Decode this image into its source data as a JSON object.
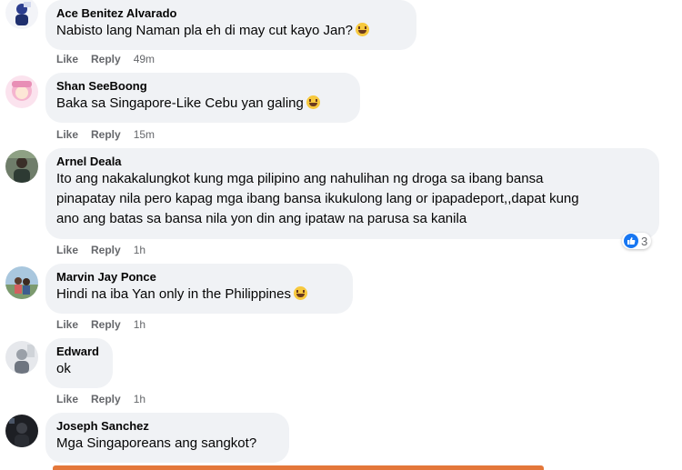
{
  "actions": {
    "like": "Like",
    "reply": "Reply"
  },
  "comments": [
    {
      "name": "Ace Benitez Alvarado",
      "lines": [
        "Nabisto lang Naman pla eh di may cut kayo Jan?"
      ],
      "time": "49m",
      "emoji": "grinning-face"
    },
    {
      "name": "Shan SeeBoong",
      "lines": [
        "Baka sa Singapore-Like Cebu yan galing"
      ],
      "time": "15m",
      "emoji": "laughing-face"
    },
    {
      "name": "Arnel Deala",
      "lines": [
        "Ito ang nakakalungkot kung mga pilipino ang nahulihan ng droga sa ibang bansa",
        "pinapatay nila pero kapag mga ibang bansa ikukulong lang or ipapadeport,,dapat kung",
        "ano ang batas sa bansa nila yon din ang ipataw na parusa sa kanila"
      ],
      "time": "1h",
      "reaction_count": "3"
    },
    {
      "name": "Marvin Jay Ponce",
      "lines": [
        "Hindi na iba Yan only in the Philippines"
      ],
      "time": "1h",
      "emoji": "laughing-face"
    },
    {
      "name": "Edward",
      "lines": [
        "ok"
      ],
      "time": "1h"
    },
    {
      "name": "Joseph Sanchez",
      "lines": [
        "Mga Singaporeans ang sangkot?"
      ]
    }
  ],
  "colors": {
    "bubble": "#f0f2f5",
    "meta": "#65676b",
    "like_blue": "#1877f2"
  }
}
